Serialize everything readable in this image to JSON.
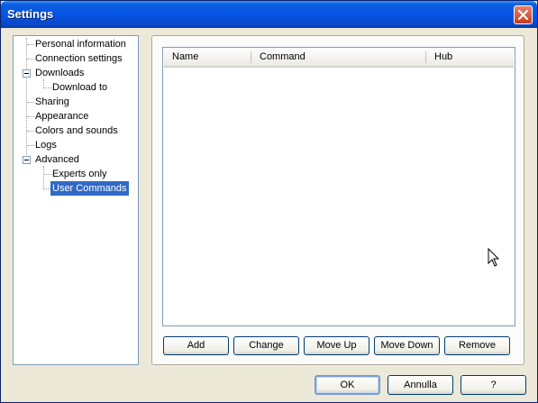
{
  "window": {
    "title": "Settings"
  },
  "tree": {
    "items": [
      {
        "label": "Personal information",
        "level": 0
      },
      {
        "label": "Connection settings",
        "level": 0
      },
      {
        "label": "Downloads",
        "level": 0,
        "expanded": true
      },
      {
        "label": "Download to",
        "level": 1
      },
      {
        "label": "Sharing",
        "level": 0
      },
      {
        "label": "Appearance",
        "level": 0
      },
      {
        "label": "Colors and sounds",
        "level": 0
      },
      {
        "label": "Logs",
        "level": 0
      },
      {
        "label": "Advanced",
        "level": 0,
        "expanded": true
      },
      {
        "label": "Experts only",
        "level": 1
      },
      {
        "label": "User Commands",
        "level": 1,
        "selected": true
      }
    ]
  },
  "list": {
    "columns": [
      "Name",
      "Command",
      "Hub"
    ],
    "rows": []
  },
  "list_buttons": {
    "add": "Add",
    "change": "Change",
    "move_up": "Move Up",
    "move_down": "Move Down",
    "remove": "Remove"
  },
  "dialog_buttons": {
    "ok": "OK",
    "cancel": "Annulla",
    "help": "?"
  },
  "colors": {
    "titlebar": "#0554e3",
    "selection": "#316ac5",
    "face": "#ece9d8"
  }
}
